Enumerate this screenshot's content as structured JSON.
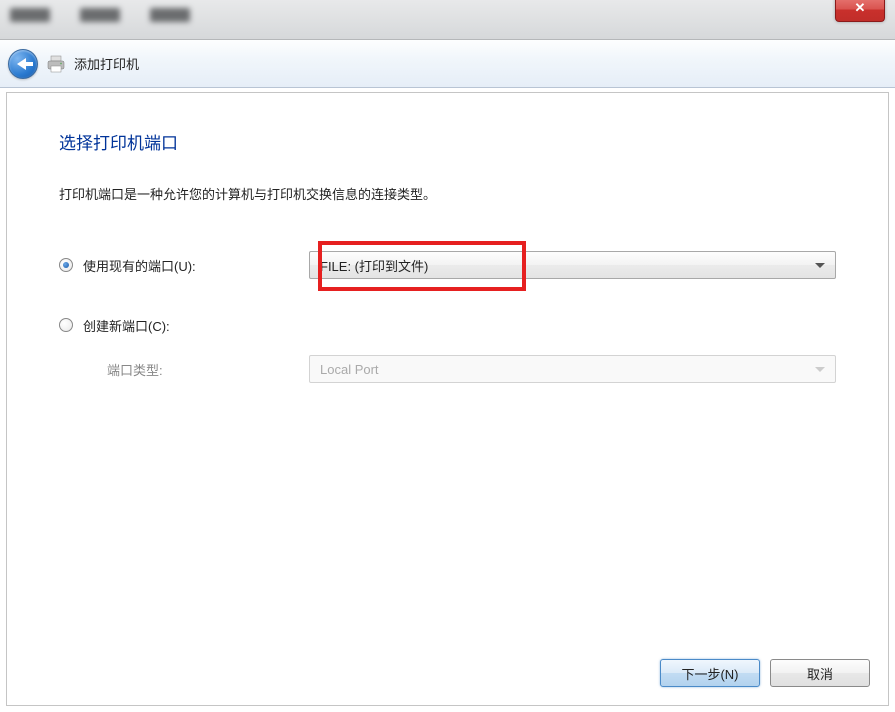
{
  "titlebar": {
    "close_symbol": "✕"
  },
  "wizard": {
    "title": "添加打印机"
  },
  "page": {
    "heading": "选择打印机端口",
    "description": "打印机端口是一种允许您的计算机与打印机交换信息的连接类型。"
  },
  "options": {
    "use_existing": {
      "label": "使用现有的端口(U):",
      "selected_value": "FILE: (打印到文件)",
      "checked": true
    },
    "create_new": {
      "label": "创建新端口(C):",
      "sub_label": "端口类型:",
      "selected_value": "Local Port",
      "checked": false
    }
  },
  "buttons": {
    "next": "下一步(N)",
    "cancel": "取消"
  }
}
